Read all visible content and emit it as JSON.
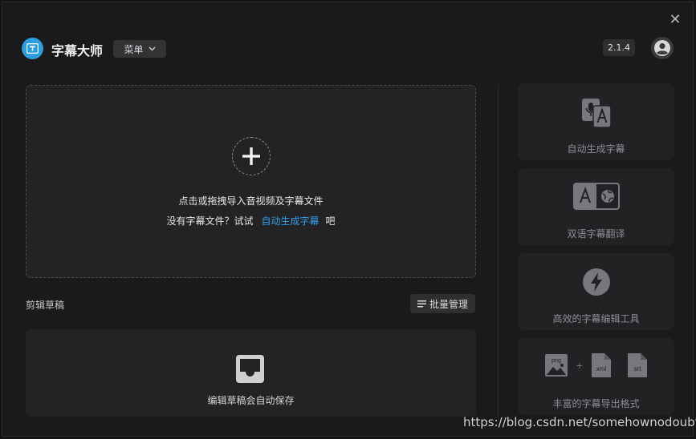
{
  "header": {
    "app_title": "字幕大师",
    "menu_label": "菜单",
    "version": "2.1.4",
    "close_symbol": "✕"
  },
  "dropzone": {
    "main_text": "点击或拖拽导入音视频及字幕文件",
    "sub_prefix": "没有字幕文件？试试",
    "sub_link": "自动生成字幕",
    "sub_suffix": "吧"
  },
  "drafts": {
    "label": "剪辑草稿",
    "batch_button": "批量管理",
    "empty_text": "编辑草稿会自动保存"
  },
  "features": [
    {
      "label": "自动生成字幕",
      "icon": "mic-translate-icon"
    },
    {
      "label": "双语字幕翻译",
      "icon": "bilingual-translate-icon"
    },
    {
      "label": "高效的字幕编辑工具",
      "icon": "lightning-icon"
    },
    {
      "label": "丰富的字幕导出格式",
      "icon": "export-formats-icon",
      "formats": [
        "png",
        "+",
        "xml",
        "srt"
      ]
    }
  ],
  "watermark": "https://blog.csdn.net/somehownodoubts",
  "colors": {
    "accent": "#2f9fe6",
    "logo": "#2b9ee0",
    "background": "#1a1a1c"
  }
}
